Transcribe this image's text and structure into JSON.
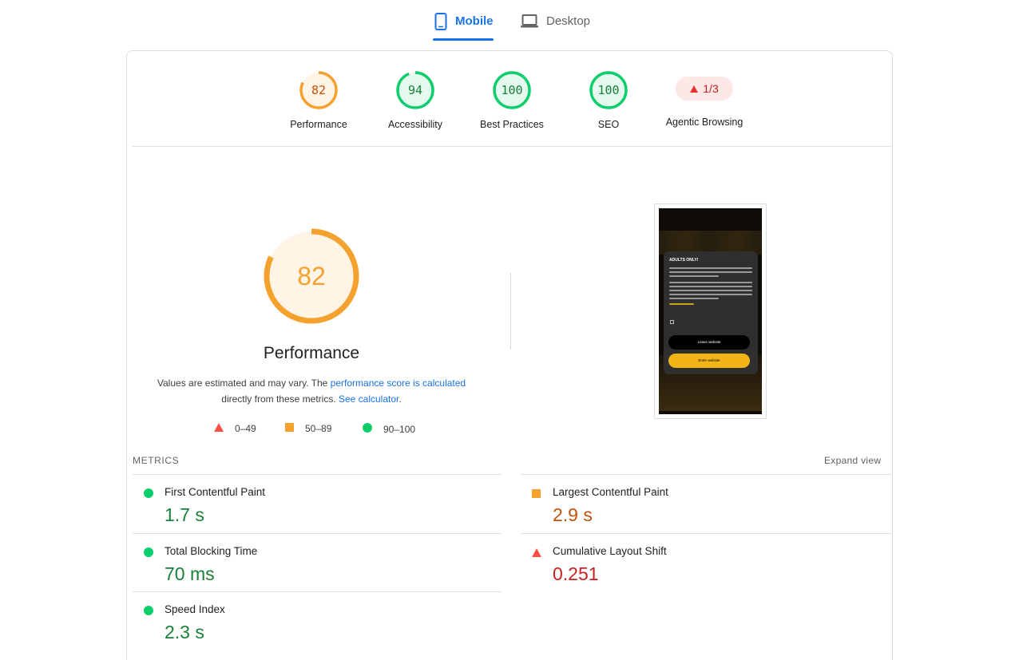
{
  "tabs": {
    "mobile": "Mobile",
    "desktop": "Desktop",
    "selected": "Mobile"
  },
  "scores": [
    {
      "label": "Performance",
      "value": "82",
      "fraction": 0.82,
      "color": "#f4a22d",
      "fill": "#fff4e5",
      "text_color": "#c5510b"
    },
    {
      "label": "Accessibility",
      "value": "94",
      "fraction": 0.94,
      "color": "#0cce6b",
      "fill": "#e6f9ef",
      "text_color": "#188038"
    },
    {
      "label": "Best Practices",
      "value": "100",
      "fraction": 1.0,
      "color": "#0cce6b",
      "fill": "#e6f9ef",
      "text_color": "#188038"
    },
    {
      "label": "SEO",
      "value": "100",
      "fraction": 1.0,
      "color": "#0cce6b",
      "fill": "#e6f9ef",
      "text_color": "#188038"
    }
  ],
  "agentic": {
    "label": "Agentic Browsing",
    "value": "1/3",
    "color": "#c5221f"
  },
  "performance": {
    "score": "82",
    "fraction": 0.82,
    "title": "Performance",
    "desc_pre": "Values are estimated and may vary. The ",
    "desc_link1": "performance score is calculated",
    "desc_mid": "directly from these metrics. ",
    "desc_link2": "See calculator",
    "desc_post": "."
  },
  "legend": {
    "fail": "0–49",
    "average": "50–89",
    "pass": "90–100"
  },
  "screenshot": {
    "modal_title": "ADULTS ONLY!",
    "leave_button": "Leave website",
    "enter_button": "Enter website"
  },
  "metrics": {
    "header": "METRICS",
    "expand": "Expand view",
    "items": [
      {
        "name": "First Contentful Paint",
        "value": "1.7 s",
        "status": "pass"
      },
      {
        "name": "Largest Contentful Paint",
        "value": "2.9 s",
        "status": "average"
      },
      {
        "name": "Total Blocking Time",
        "value": "70 ms",
        "status": "pass"
      },
      {
        "name": "Cumulative Layout Shift",
        "value": "0.251",
        "status": "fail"
      },
      {
        "name": "Speed Index",
        "value": "2.3 s",
        "status": "pass"
      }
    ]
  },
  "colors": {
    "accent": "#1a73e8",
    "pass": "#0cce6b",
    "average": "#f4a22d",
    "fail": "#ff4e42"
  }
}
